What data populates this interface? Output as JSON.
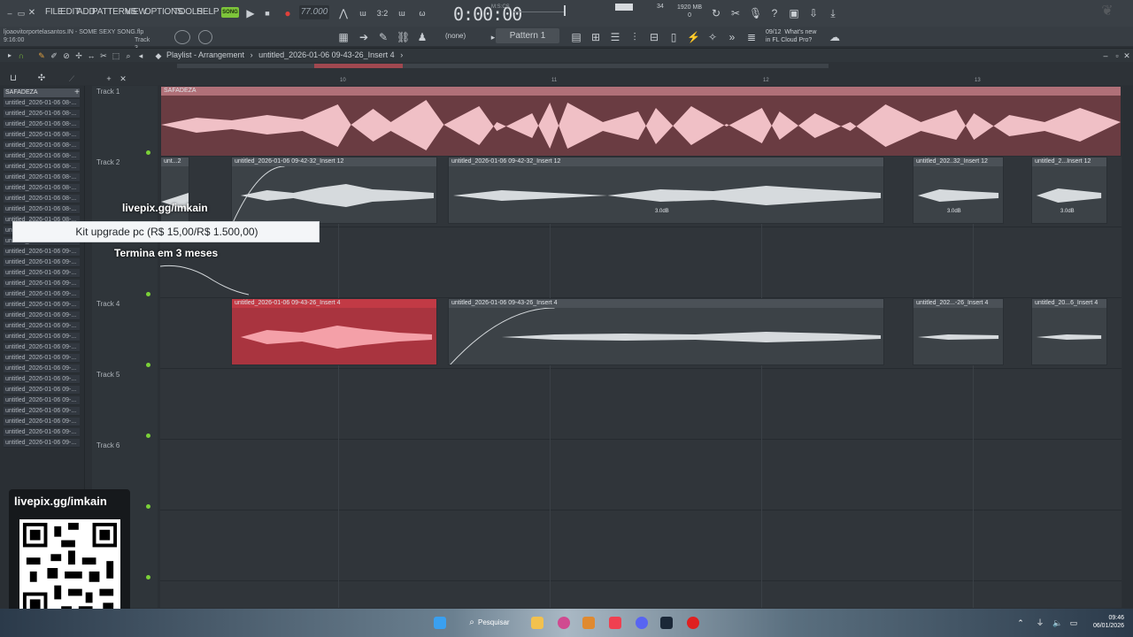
{
  "menu": [
    "FILE",
    "EDIT",
    "ADD",
    "PATTERNS",
    "VIEW",
    "OPTIONS",
    "TOOLS",
    "HELP"
  ],
  "song_mode": "SONG",
  "tempo": "77.000",
  "time": "0:00:00",
  "time_unit": "M:S:CS",
  "cpu_meter": "34",
  "memory": "1920 MB",
  "memory_sub": "0",
  "project": {
    "path": "ljoaovitorportelasantos.IN - SOME SEXY SONG.flp",
    "track": "Track 3",
    "time": "9:16:00"
  },
  "snap": "(none)",
  "pattern": "Pattern 1",
  "news": {
    "date": "09/12",
    "line1": "What's new",
    "line2": "in FL Cloud Pro?"
  },
  "playlist": {
    "title": "Playlist - Arrangement",
    "breadcrumb": "untitled_2026-01-06 09-43-26_Insert 4"
  },
  "browser": {
    "header": "SAFADEZA",
    "items": [
      "untitled_2026-01-06 08-...",
      "untitled_2026-01-06 08-...",
      "untitled_2026-01-06 08-...",
      "untitled_2026-01-06 08-...",
      "untitled_2026-01-06 08-...",
      "untitled_2026-01-06 08-...",
      "untitled_2026-01-06 08-...",
      "untitled_2026-01-06 08-...",
      "untitled_2026-01-06 08-...",
      "untitled_2026-01-06 08-...",
      "untitled_2026-01-06 08-...",
      "untitled_2026-01-06 08-...",
      "untitled_2026-01-06 08-...",
      "untitled_2026-01-06 08-...",
      "untitled_2026-01-06 09-...",
      "untitled_2026-01-06 09-...",
      "untitled_2026-01-06 09-...",
      "untitled_2026-01-06 09-...",
      "untitled_2026-01-06 09-...",
      "untitled_2026-01-06 09-...",
      "untitled_2026-01-06 09-...",
      "untitled_2026-01-06 09-...",
      "untitled_2026-01-06 09-...",
      "untitled_2026-01-06 09-...",
      "untitled_2026-01-06 09-...",
      "untitled_2026-01-06 09-...",
      "untitled_2026-01-06 09-...",
      "untitled_2026-01-06 09-...",
      "untitled_2026-01-06 09-...",
      "untitled_2026-01-06 09-...",
      "untitled_2026-01-06 09-...",
      "untitled_2026-01-06 09-...",
      "untitled_2026-01-06 09-..."
    ]
  },
  "ruler": [
    "10",
    "11",
    "12",
    "13"
  ],
  "tracks": [
    "Track 1",
    "Track 2",
    "Track 3",
    "Track 4",
    "Track 5",
    "Track 6"
  ],
  "clips": {
    "t1": {
      "title": "SAFADEZA"
    },
    "t2a": {
      "title": "unt...2"
    },
    "t2b": {
      "title": "untitled_2026-01-06 09-42-32_Insert 12"
    },
    "t2c": {
      "title": "untitled_2026-01-06 09-42-32_Insert 12",
      "db": "3.0dB"
    },
    "t2d": {
      "title": "untitled_202..32_Insert 12",
      "db": "3.0dB"
    },
    "t2e": {
      "title": "untitled_2...Insert 12",
      "db": "3.0dB"
    },
    "t4a": {
      "title": "untitled_2026-01-06 09-43-26_Insert 4"
    },
    "t4b": {
      "title": "untitled_2026-01-06 09-43-26_Insert 4"
    },
    "t4c": {
      "title": "untitled_202...-26_Insert 4"
    },
    "t4d": {
      "title": "untitled_20...6_Insert 4"
    }
  },
  "overlay": {
    "livepix_top": "livepix.gg/imkain",
    "kit": "Kit upgrade pc (R$ 15,00/R$ 1.500,00)",
    "ends": "Termina em 3 meses",
    "livepix_qr": "livepix.gg/imkain"
  },
  "taskbar": {
    "search": "Pesquisar",
    "time": "09:46",
    "date": "06/01/2026"
  },
  "colors": {
    "accent": "#7dc43a",
    "clip_pink": "#c96b72",
    "clip_red": "#c23a45"
  }
}
